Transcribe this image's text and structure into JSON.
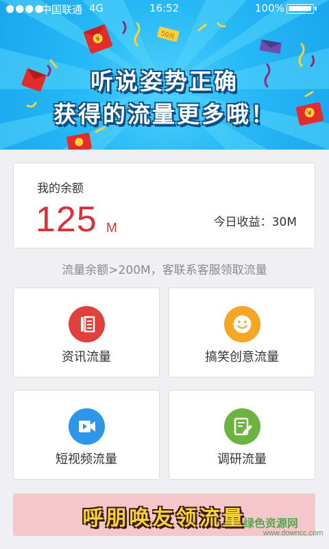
{
  "status_bar": {
    "signal": "●●●●",
    "carrier": "中国联通",
    "network": "4G",
    "time": "16:52",
    "battery": "100%"
  },
  "banner": {
    "line1": "听说姿势正确",
    "line2": "获得的流量更多哦！",
    "tag": "50元",
    "envelope_glyph": "¥"
  },
  "balance": {
    "label": "我的余额",
    "value": "125",
    "unit": "M",
    "today": "今日收益：30M"
  },
  "notice": "流量余额>200M，客联系客服领取流量",
  "tiles": [
    {
      "label": "资讯流量",
      "icon": "news-icon",
      "color": "#e0413a"
    },
    {
      "label": "搞笑创意流量",
      "icon": "smile-icon",
      "color": "#f5a623"
    },
    {
      "label": "短视频流量",
      "icon": "video-camera-icon",
      "color": "#2c97e8"
    },
    {
      "label": "调研流量",
      "icon": "survey-edit-icon",
      "color": "#6db33f"
    }
  ],
  "invite": {
    "label": "呼朋唤友领流量"
  },
  "watermark": {
    "brand": "绿色资源网",
    "url": "www.downcc.com"
  },
  "colors": {
    "accent": "#dd2f3a",
    "banner": "#27b9f6"
  }
}
